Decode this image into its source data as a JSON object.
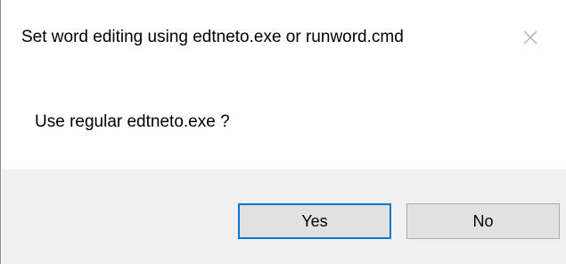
{
  "dialog": {
    "title": "Set word editing using edtneto.exe or runword.cmd",
    "close_icon": "close-icon",
    "message": "Use regular edtneto.exe ?",
    "buttons": {
      "yes_label": "Yes",
      "no_label": "No"
    },
    "colors": {
      "footer_background": "#f0f0f0",
      "button_background": "#e1e1e1",
      "default_button_border": "#0078d7",
      "button_border": "#adadad"
    }
  }
}
